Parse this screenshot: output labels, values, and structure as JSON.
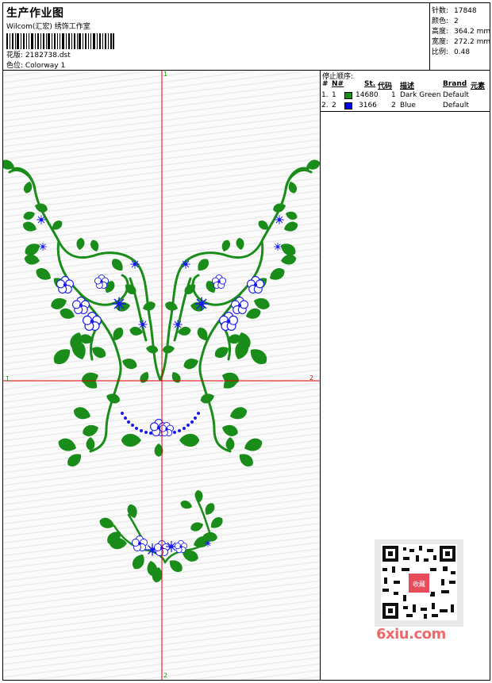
{
  "header": {
    "title": "生产作业图",
    "software": "Wilcom(汇宏) 绣饰工作室",
    "design_label": "花版: 2182738.dst",
    "colorway_label": "色位:  Colorway 1"
  },
  "stats": [
    {
      "key": "针数:",
      "value": "17848"
    },
    {
      "key": "颜色:",
      "value": "2"
    },
    {
      "key": "高度:",
      "value": "364.2 mm"
    },
    {
      "key": "宽度:",
      "value": "272.2 mm"
    },
    {
      "key": "比例:",
      "value": "0.48"
    }
  ],
  "stop_sequence": {
    "title": "停止顺序:",
    "headers": {
      "hash": "#",
      "n": "N#",
      "st": "St.",
      "code": "代码",
      "desc": "描述",
      "brand": "Brand",
      "element": "元素"
    },
    "rows": [
      {
        "index": "1.",
        "n": "1",
        "color": "#1a8c1a",
        "st": "14680",
        "code": "1",
        "desc": "Dark Green",
        "brand": "Default"
      },
      {
        "index": "2.",
        "n": "2",
        "color": "#0000ee",
        "st": "3166",
        "code": "2",
        "desc": "Blue",
        "brand": "Default"
      }
    ]
  },
  "axes": {
    "top_label": "1",
    "bottom_label": "2",
    "left_label": "1",
    "right_label": "2",
    "color": "#e00000"
  },
  "colors": {
    "green": "#1a8c1a",
    "blue": "#1a1aee"
  },
  "watermark": {
    "text": "6xiu.com",
    "badge": "收藏"
  }
}
